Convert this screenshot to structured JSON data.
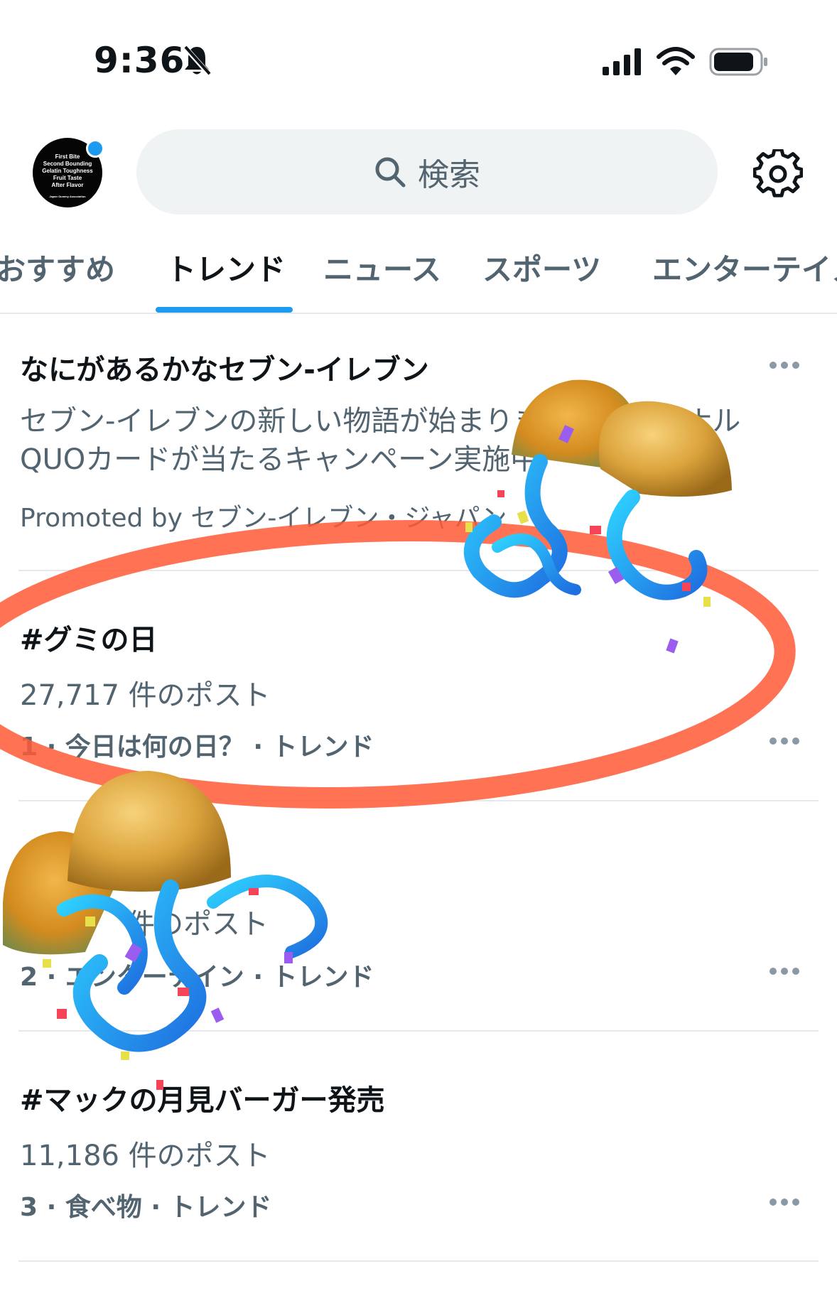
{
  "status_bar": {
    "time": "9:36"
  },
  "header": {
    "avatar_lines": [
      "First Bite",
      "Second Bounding",
      "Gelatin Toughness",
      "Fruit Taste",
      "After Flavor"
    ],
    "avatar_org": "Japan Gummy Association",
    "search_placeholder": "検索"
  },
  "tabs": [
    {
      "label": "おすすめ"
    },
    {
      "label": "トレンド"
    },
    {
      "label": "ニュース"
    },
    {
      "label": "スポーツ"
    },
    {
      "label": "エンターテイメ"
    }
  ],
  "trends": [
    {
      "title": "なにがあるかなセブン-イレブン",
      "description": "セブン-イレブンの新しい物語が始まります！オリジナル QUOカードが当たるキャンペーン実施中",
      "meta": "Promoted by セブン-イレブン・ジャパン"
    },
    {
      "title": "#グミの日",
      "posts": "27,717 件のポスト",
      "meta": "1 · 今日は何の日？ · トレンド"
    },
    {
      "title": "",
      "posts": "件のポスト",
      "meta": "2 · エンターテイン · トレンド"
    },
    {
      "title": "#マックの月見バーガー発売",
      "posts": "11,186 件のポスト",
      "meta": "3 · 食べ物 · トレンド"
    }
  ],
  "colors": {
    "accent": "#1d9bf0",
    "text_primary": "#0f1419",
    "text_secondary": "#536471",
    "search_bg": "#eff3f4",
    "highlight_ring": "#ff5a36"
  }
}
